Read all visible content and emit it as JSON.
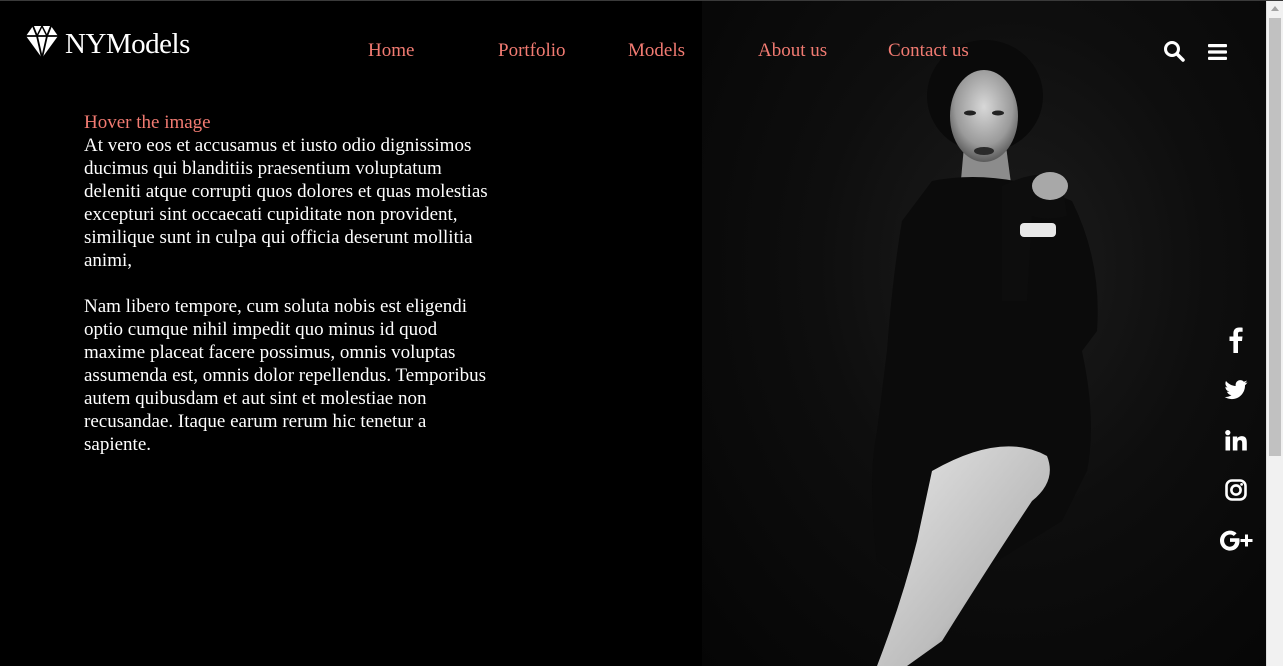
{
  "brand": {
    "name": "NYModels",
    "logo_icon": "diamond-icon"
  },
  "nav": {
    "items": [
      {
        "label": "Home"
      },
      {
        "label": "Portfolio"
      },
      {
        "label": "Models"
      },
      {
        "label": "About us"
      },
      {
        "label": "Contact us"
      }
    ],
    "search_icon": "search-icon",
    "menu_icon": "hamburger-menu-icon"
  },
  "content": {
    "heading": "Hover the image",
    "paragraph1": "At vero eos et accusamus et iusto odio dignissimos ducimus qui blanditiis praesentium voluptatum deleniti atque corrupti quos dolores et quas molestias excepturi sint occaecati cupiditate non provident, similique sunt in culpa qui officia deserunt mollitia animi,",
    "paragraph2": "Nam libero tempore, cum soluta nobis est eligendi optio cumque nihil impedit quo minus id quod maxime placeat facere possimus, omnis voluptas assumenda est, omnis dolor repellendus. Temporibus autem quibusdam et aut sint et molestiae non recusandae. Itaque earum rerum hic tenetur a sapiente."
  },
  "social": [
    "facebook-icon",
    "twitter-icon",
    "linkedin-icon",
    "instagram-icon",
    "google-plus-icon"
  ],
  "colors": {
    "accent": "#f27b72",
    "background": "#000000",
    "text": "#ffffff"
  }
}
